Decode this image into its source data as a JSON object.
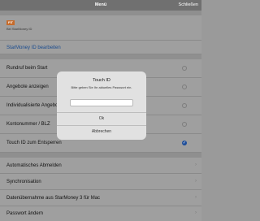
{
  "nav": {
    "title": "Menü",
    "right": "Schließen"
  },
  "account": {
    "logo_text": "FIT",
    "subtext": "Bei StarMoney ID",
    "link": "StarMoney ID bearbeiten"
  },
  "settings": [
    {
      "label": "Rundruf beim Start"
    },
    {
      "label": "Angebote anzeigen"
    },
    {
      "label": "Individualisierte Angebote"
    },
    {
      "label": "Kontonummer / BLZ"
    },
    {
      "label": "Touch ID zum Entsperren"
    }
  ],
  "menu": [
    {
      "label": "Automatisches Abmelden"
    },
    {
      "label": "Synchronisation"
    },
    {
      "label": "Datenübernahme aus StarMoney 3 für Mac"
    },
    {
      "label": "Passwort ändern"
    }
  ],
  "dialog": {
    "title": "Touch ID",
    "message": "Bitte geben Sie Ihr aktuelles Passwort ein.",
    "input_value": "",
    "ok": "Ok",
    "cancel": "Abbrechen"
  }
}
